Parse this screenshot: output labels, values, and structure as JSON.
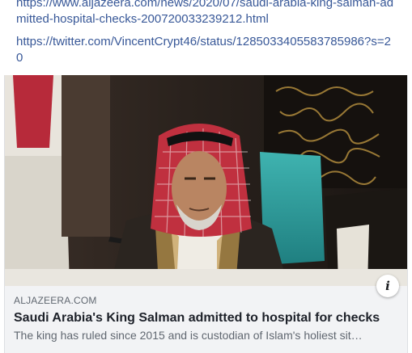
{
  "post": {
    "links": [
      "https://www.aljazeera.com/news/2020/07/saudi-arabia-king-salman-admitted-hospital-checks-200720033239212.html",
      "https://twitter.com/VincentCrypt46/status/1285033405583785986?s=20"
    ]
  },
  "preview": {
    "image_icon": "news-photo",
    "info_icon": "i",
    "domain": "ALJAZEERA.COM",
    "headline": "Saudi Arabia's King Salman admitted to hospital for checks",
    "description": "The king has ruled since 2015 and is custodian of Islam's holiest sit…"
  },
  "colors": {
    "link": "#385898",
    "preview_bg": "#f2f3f5",
    "headline": "#1d2129",
    "meta_text": "#606770"
  }
}
